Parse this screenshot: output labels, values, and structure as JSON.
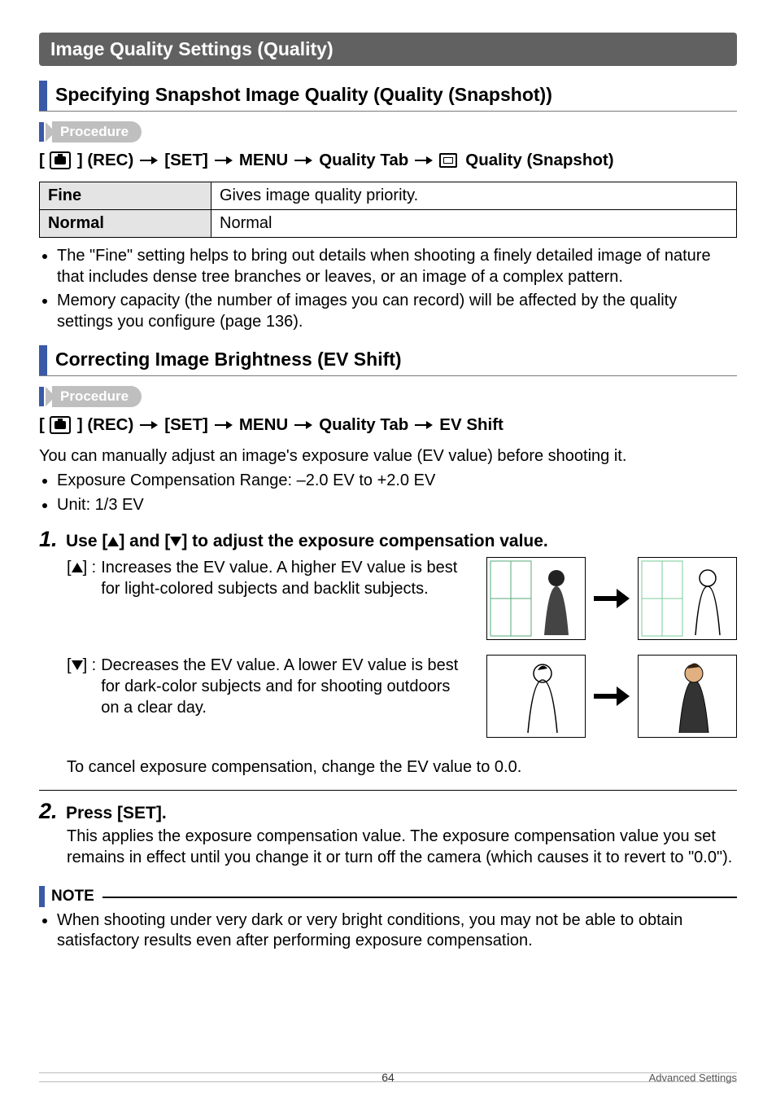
{
  "section_title": "Image Quality Settings (Quality)",
  "sub1": {
    "title": "Specifying Snapshot Image Quality (Quality (Snapshot))",
    "procedure_label": "Procedure",
    "path": {
      "p1_prefix": "[",
      "p1_suffix": "] (REC)",
      "p2": "[SET]",
      "p3": "MENU",
      "p4": "Quality Tab",
      "p5": "Quality (Snapshot)"
    },
    "table": {
      "r1_label": "Fine",
      "r1_value": "Gives image quality priority.",
      "r2_label": "Normal",
      "r2_value": "Normal"
    },
    "bullets": [
      "The \"Fine\" setting helps to bring out details when shooting a finely detailed image of nature that includes dense tree branches or leaves, or an image of a complex pattern.",
      "Memory capacity (the number of images you can record) will be affected by the quality settings you configure (page 136)."
    ]
  },
  "sub2": {
    "title": "Correcting Image Brightness (EV Shift)",
    "procedure_label": "Procedure",
    "path": {
      "p1_prefix": "[",
      "p1_suffix": "] (REC)",
      "p2": "[SET]",
      "p3": "MENU",
      "p4": "Quality Tab",
      "p5": "EV Shift"
    },
    "intro": "You can manually adjust an image's exposure value (EV value) before shooting it.",
    "bullets": [
      "Exposure Compensation Range: –2.0 EV to +2.0 EV",
      "Unit: 1/3 EV"
    ],
    "step1": {
      "num": "1.",
      "title_pre": "Use [",
      "title_mid": "] and [",
      "title_post": "] to adjust the exposure compensation value.",
      "up_key": "[",
      "up_key_post": "] :",
      "up_text": "Increases the EV value. A higher EV value is best for light-colored subjects and backlit subjects.",
      "down_key": "[",
      "down_key_post": "] :",
      "down_text": "Decreases the EV value. A lower EV value is best for dark-color subjects and for shooting outdoors on a clear day.",
      "cancel": "To cancel exposure compensation, change the EV value to 0.0."
    },
    "step2": {
      "num": "2.",
      "title": "Press [SET].",
      "body": "This applies the exposure compensation value. The exposure compensation value you set remains in effect until you change it or turn off the camera (which causes it to revert to \"0.0\")."
    }
  },
  "note": {
    "label": "NOTE",
    "bullet": "When shooting under very dark or very bright conditions, you may not be able to obtain satisfactory results even after performing exposure compensation."
  },
  "footer": {
    "page": "64",
    "title": "Advanced Settings"
  }
}
